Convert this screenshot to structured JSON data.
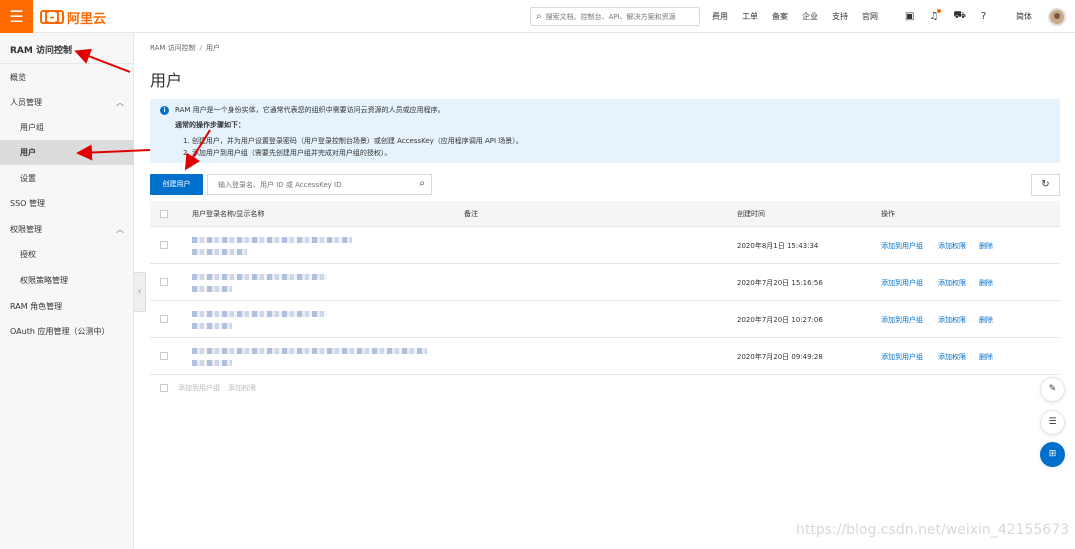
{
  "topbar": {
    "logo_mark": "[-]",
    "logo_text": "阿里云",
    "search_placeholder": "搜索文档、控制台、API、解决方案和资源",
    "nav_links": [
      "费用",
      "工单",
      "备案",
      "企业",
      "支持",
      "官网"
    ],
    "icons": [
      "terminal-icon",
      "bell-icon",
      "cart-icon",
      "help-icon"
    ],
    "lang": "简体"
  },
  "sidebar": {
    "title": "RAM 访问控制",
    "items": [
      {
        "label": "概览"
      },
      {
        "label": "人员管理",
        "chevron": "︿"
      },
      {
        "label": "用户组"
      },
      {
        "label": "用户"
      },
      {
        "label": "设置"
      },
      {
        "label": "SSO 管理"
      },
      {
        "label": "权限管理",
        "chevron": "︿"
      },
      {
        "label": "授权"
      },
      {
        "label": "权限策略管理"
      },
      {
        "label": "RAM 角色管理"
      },
      {
        "label": "OAuth 应用管理（公测中）"
      }
    ]
  },
  "breadcrumb": {
    "root": "RAM 访问控制",
    "sep": "/",
    "current": "用户"
  },
  "page_title": "用户",
  "notice": {
    "line1": "RAM 用户是一个身份实体，它通常代表您的组织中需要访问云资源的人员或应用程序。",
    "line2": "通常的操作步骤如下：",
    "line3": "1. 创建用户，并为用户设置登录密码（用户登录控制台场景）或创建 AccessKey（应用程序调用 API 场景）。",
    "line4": "2. 添加用户到用户组（需要先创建用户组并完成对用户组的授权）。"
  },
  "toolbar": {
    "create_label": "创建用户",
    "search_placeholder": "输入登录名、用户 ID 或 AccessKey ID",
    "refresh_icon": "↻"
  },
  "table": {
    "headers": [
      "用户登录名称/显示名称",
      "备注",
      "创建时间",
      "操作"
    ],
    "rows": [
      {
        "created": "2020年8月1日 15:43:34",
        "actions": [
          "添加到用户组",
          "添加权限",
          "删除"
        ]
      },
      {
        "created": "2020年7月20日 15:16:56",
        "actions": [
          "添加到用户组",
          "添加权限",
          "删除"
        ]
      },
      {
        "created": "2020年7月20日 10:27:06",
        "actions": [
          "添加到用户组",
          "添加权限",
          "删除"
        ]
      },
      {
        "created": "2020年7月20日 09:49:28",
        "actions": [
          "添加到用户组",
          "添加权限",
          "删除"
        ]
      }
    ],
    "footer_actions": [
      "添加到用户组",
      "添加权限"
    ]
  },
  "watermark": "https://blog.csdn.net/weixin_42155673",
  "colors": {
    "brand": "#ff6a00",
    "primary": "#0070cc",
    "annotation_arrow": "#e00000"
  }
}
